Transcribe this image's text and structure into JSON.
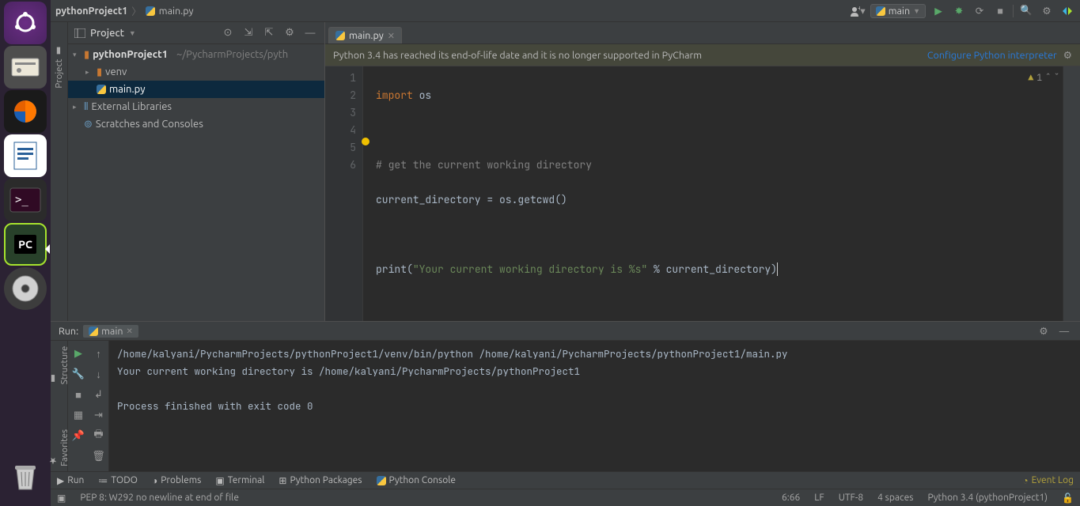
{
  "breadcrumb": {
    "project": "pythonProject1",
    "file": "main.py"
  },
  "run_config": {
    "label": "main"
  },
  "project_panel": {
    "title": "Project",
    "root_name": "pythonProject1",
    "root_path": "~/PycharmProjects/pyth",
    "venv": "venv",
    "main_file": "main.py",
    "ext_libs": "External Libraries",
    "scratches": "Scratches and Consoles"
  },
  "tab": {
    "filename": "main.py"
  },
  "eol_banner": {
    "msg": "Python 3.4 has reached its end-of-life date and it is no longer supported in PyCharm",
    "configure": "Configure Python interpreter"
  },
  "gutter": {
    "lines": [
      "1",
      "2",
      "3",
      "4",
      "5",
      "6"
    ]
  },
  "code": {
    "l1_kw": "import",
    "l1_mod": " os",
    "l3_cmt": "# get the current working directory",
    "l4": "current_directory = os.getcwd()",
    "l6_fn": "print",
    "l6_p": "(",
    "l6_str": "\"Your current working directory is %s\"",
    "l6_mid": " % current_directory",
    "l6_e": ")"
  },
  "warn_count": "1",
  "run_panel": {
    "label": "Run:",
    "tab_name": "main"
  },
  "console_out": "/home/kalyani/PycharmProjects/pythonProject1/venv/bin/python /home/kalyani/PycharmProjects/pythonProject1/main.py\nYour current working directory is /home/kalyani/PycharmProjects/pythonProject1\n\nProcess finished with exit code 0",
  "side_tabs": {
    "project": "Project",
    "structure": "Structure",
    "favorites": "Favorites"
  },
  "bottom_tools": {
    "run": "Run",
    "todo": "TODO",
    "problems": "Problems",
    "terminal": "Terminal",
    "pypkg": "Python Packages",
    "pyconsole": "Python Console",
    "eventlog": "Event Log"
  },
  "status": {
    "pep8": "PEP 8: W292 no newline at end of file",
    "pos": "6:66",
    "lf": "LF",
    "enc": "UTF-8",
    "indent": "4 spaces",
    "interp": "Python 3.4 (pythonProject1)"
  }
}
